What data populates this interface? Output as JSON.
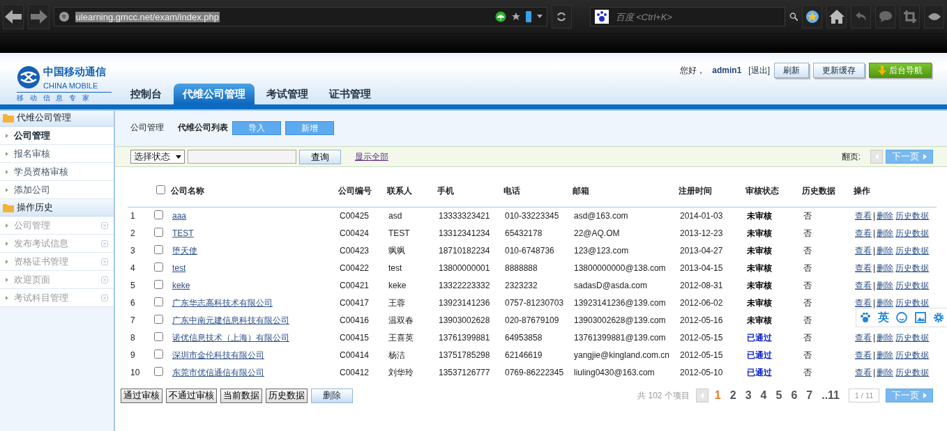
{
  "browser": {
    "url": "ulearning.gmcc.net/exam/index.php",
    "url_selected": true,
    "search_placeholder": "百度 <Ctrl+K>"
  },
  "header": {
    "logo": {
      "cn": "中国移动通信",
      "en": "CHINA MOBILE",
      "slogan": "移 动 信 息 专 家"
    },
    "tabs": [
      {
        "label": "控制台",
        "selected": false
      },
      {
        "label": "代维公司管理",
        "selected": true
      },
      {
        "label": "考试管理",
        "selected": false
      },
      {
        "label": "证书管理",
        "selected": false
      }
    ],
    "greeting": "您好，",
    "user": "admin1",
    "logout": "[退出]",
    "buttons": [
      {
        "label": "刷新",
        "kind": "plain"
      },
      {
        "label": "更新缓存",
        "kind": "plain"
      },
      {
        "label": "后台导航",
        "kind": "nav"
      }
    ]
  },
  "sidebar": [
    {
      "title": "代维公司管理",
      "items": [
        {
          "label": "公司管理",
          "selected": true,
          "closable": false
        },
        {
          "label": "报名审核",
          "selected": false,
          "closable": false
        },
        {
          "label": "学员资格审核",
          "selected": false,
          "closable": false
        },
        {
          "label": "添加公司",
          "selected": false,
          "closable": false
        }
      ]
    },
    {
      "title": "操作历史",
      "items": [
        {
          "label": "公司管理",
          "selected": false,
          "closable": true
        },
        {
          "label": "发布考试信息",
          "selected": false,
          "closable": true
        },
        {
          "label": "资格证书管理",
          "selected": false,
          "closable": true
        },
        {
          "label": "欢迎页面",
          "selected": false,
          "closable": true
        },
        {
          "label": "考试科目管理",
          "selected": false,
          "closable": true
        }
      ]
    }
  ],
  "breadcrumb": "公司管理",
  "page_title": "代维公司列表",
  "top_buttons": [
    "导入",
    "新增"
  ],
  "filter": {
    "select": "选择状态",
    "search_button": "查询",
    "show_all": "显示全部",
    "paging_label": "翻页:",
    "next": "下一页"
  },
  "table": {
    "select_all_checked": false,
    "action_separator": "|",
    "columns": [
      "公司名称",
      "公司编号",
      "联系人",
      "手机",
      "电话",
      "邮箱",
      "注册时间",
      "审核状态",
      "历史数据",
      "操作"
    ],
    "rows": [
      {
        "index": "1",
        "checked": false,
        "name": "aaa",
        "code": "C00425",
        "contact": "asd",
        "mobile": "13333323421",
        "phone": "010-33223345",
        "email": "asd@163.com",
        "date": "2014-01-03",
        "status": "未审核",
        "approved": false,
        "history": "否",
        "actions": [
          "查看",
          "删除",
          "历史数据"
        ]
      },
      {
        "index": "2",
        "checked": false,
        "name": "TEST",
        "code": "C00424",
        "contact": "TEST",
        "mobile": "13312341234",
        "phone": "65432178",
        "email": "22@AQ.OM",
        "date": "2013-12-23",
        "status": "未审核",
        "approved": false,
        "history": "否",
        "actions": [
          "查看",
          "删除",
          "历史数据"
        ]
      },
      {
        "index": "3",
        "checked": false,
        "name": "堕天使",
        "code": "C00423",
        "contact": "飒飒",
        "mobile": "18710182234",
        "phone": "010-6748736",
        "email": "123@123.com",
        "date": "2013-04-27",
        "status": "未审核",
        "approved": false,
        "history": "否",
        "actions": [
          "查看",
          "删除",
          "历史数据"
        ]
      },
      {
        "index": "4",
        "checked": false,
        "name": "test",
        "code": "C00422",
        "contact": "test",
        "mobile": "13800000001",
        "phone": "8888888",
        "email": "13800000000@138.com",
        "date": "2013-04-15",
        "status": "未审核",
        "approved": false,
        "history": "否",
        "actions": [
          "查看",
          "删除",
          "历史数据"
        ]
      },
      {
        "index": "5",
        "checked": false,
        "name": "keke",
        "code": "C00421",
        "contact": "keke",
        "mobile": "13322223332",
        "phone": "2323232",
        "email": "sadasD@asda.com",
        "date": "2012-08-31",
        "status": "未审核",
        "approved": false,
        "history": "否",
        "actions": [
          "查看",
          "删除",
          "历史数据"
        ]
      },
      {
        "index": "6",
        "checked": false,
        "name": "广东华志高科技术有限公司",
        "code": "C00417",
        "contact": "王蓉",
        "mobile": "13923141236",
        "phone": "0757-81230703",
        "email": "13923141236@139.com",
        "date": "2012-06-02",
        "status": "未审核",
        "approved": false,
        "history": "否",
        "actions": [
          "查看",
          "删除",
          "历史数据"
        ]
      },
      {
        "index": "7",
        "checked": false,
        "name": "广东中南元建信息科技有限公司",
        "code": "C00416",
        "contact": "温双春",
        "mobile": "13903002628",
        "phone": "020-87679109",
        "email": "13903002628@139.com",
        "date": "2012-05-16",
        "status": "未审核",
        "approved": false,
        "history": "否"
      },
      {
        "index": "8",
        "checked": false,
        "name": "诺优信息技术（上海）有限公司",
        "code": "C00415",
        "contact": "王喜英",
        "mobile": "13761399881",
        "phone": "64953858",
        "email": "13761399881@139.com",
        "date": "2012-05-15",
        "status": "已通过",
        "approved": true,
        "history": "否",
        "actions": [
          "查看",
          "删除",
          "历史数据"
        ]
      },
      {
        "index": "9",
        "checked": false,
        "name": "深圳市金伦科技有限公司",
        "code": "C00414",
        "contact": "杨洁",
        "mobile": "13751785298",
        "phone": "62146619",
        "email": "yangjie@kingland.com.cn",
        "date": "2012-05-15",
        "status": "已通过",
        "approved": true,
        "history": "否",
        "actions": [
          "查看",
          "删除",
          "历史数据"
        ]
      },
      {
        "index": "10",
        "checked": false,
        "name": "东莞市优信通信有限公司",
        "code": "C00412",
        "contact": "刘华玲",
        "mobile": "13537126777",
        "phone": "0769-86222345",
        "email": "liuling0430@163.com",
        "date": "2012-05-10",
        "status": "已通过",
        "approved": true,
        "history": "否",
        "actions": [
          "查看",
          "删除",
          "历史数据"
        ]
      }
    ]
  },
  "bulk_buttons": [
    {
      "label": "通过审核",
      "kind": "gray"
    },
    {
      "label": "不通过审核",
      "kind": "gray"
    },
    {
      "label": "当前数据",
      "kind": "gray"
    },
    {
      "label": "历史数据",
      "kind": "gray"
    },
    {
      "label": "删除",
      "kind": "blue"
    }
  ],
  "pager": {
    "total": "共 102 个项目",
    "pages": [
      {
        "label": "1",
        "selected": true
      },
      {
        "label": "2",
        "selected": false
      },
      {
        "label": "3",
        "selected": false
      },
      {
        "label": "4",
        "selected": false
      },
      {
        "label": "5",
        "selected": false
      },
      {
        "label": "6",
        "selected": false
      },
      {
        "label": "7",
        "selected": false
      },
      {
        "label": "..11",
        "selected": false
      }
    ],
    "jump": "1 / 11",
    "next": "下一页"
  },
  "ime_toolbar": {
    "label": "英"
  }
}
